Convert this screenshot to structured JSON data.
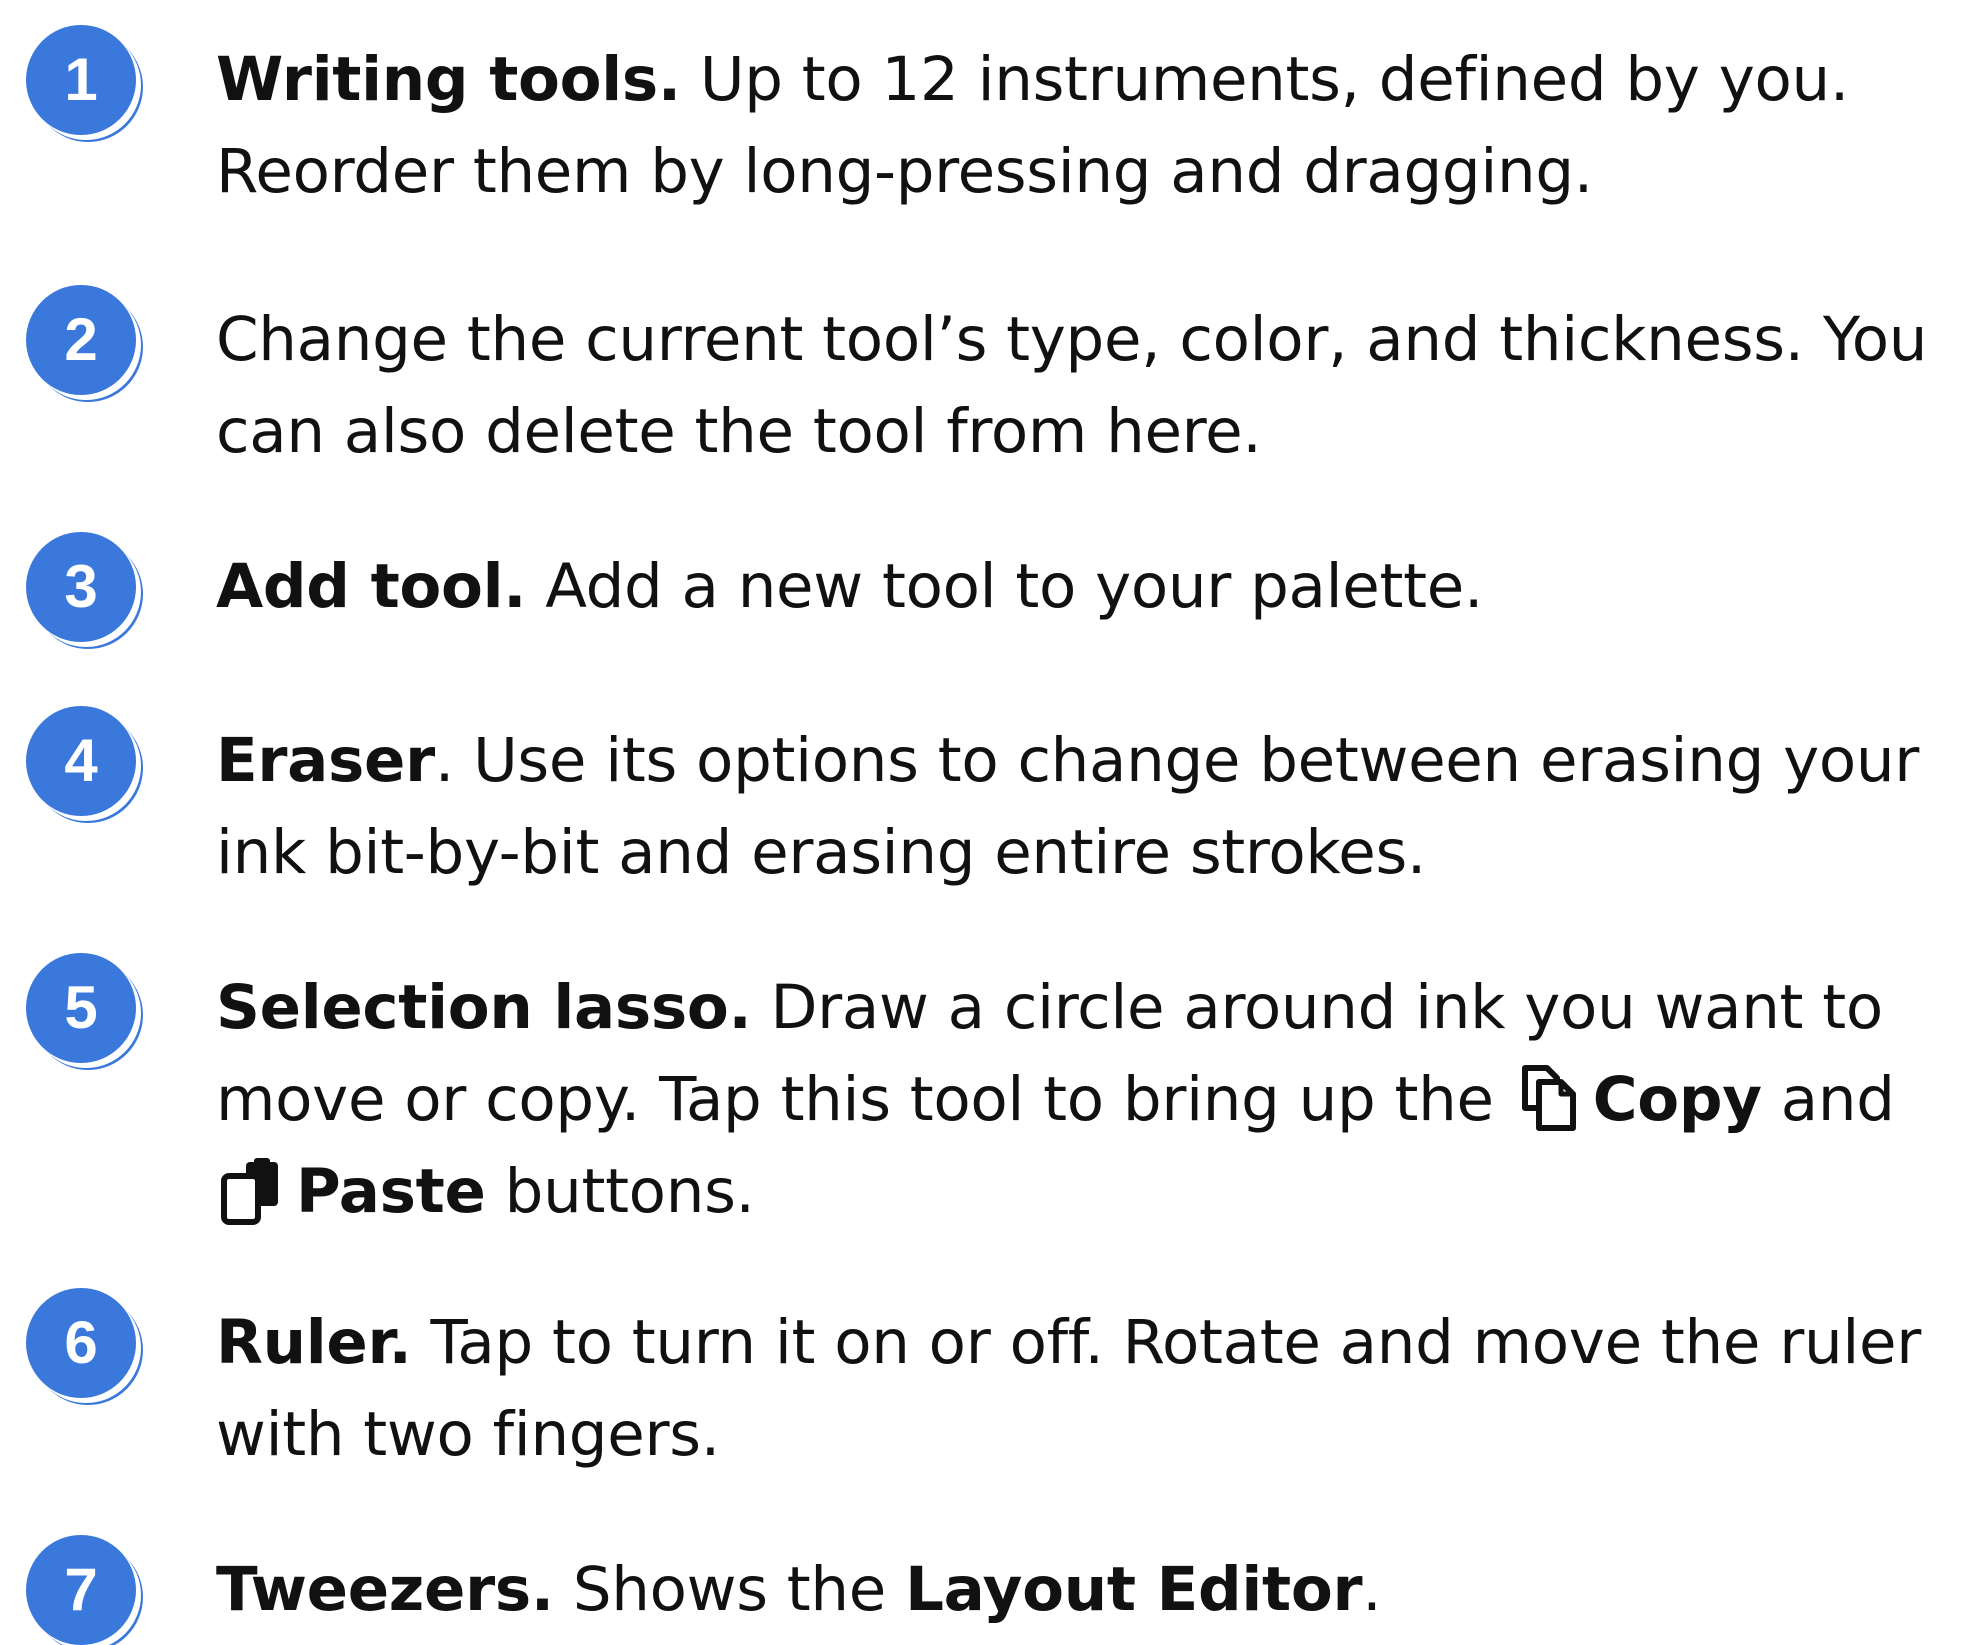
{
  "items": [
    {
      "number": "1",
      "title": "Writing tools.",
      "line1": " Up to 12 instruments, defined by you.",
      "line2": "Reorder them by long-pressing and dragging."
    },
    {
      "number": "2",
      "line1": "Change the current tool’s type, color, and thickness. You",
      "line2": "can also delete the tool from here."
    },
    {
      "number": "3",
      "title": "Add tool.",
      "line1": " Add a new tool to your palette."
    },
    {
      "number": "4",
      "title": "Eraser",
      "line1": ". Use its options to change between erasing your",
      "line2": "ink bit-by-bit and erasing entire strokes."
    },
    {
      "number": "5",
      "title": "Selection lasso.",
      "line1": " Draw a circle around ink you want to",
      "line2": "move or copy. Tap this tool to bring up the ",
      "copy_icon": "copy-icon",
      "copy_label": "Copy",
      "and_text": " and",
      "paste_icon": "paste-icon",
      "paste_label": "Paste",
      "line3": " buttons."
    },
    {
      "number": "6",
      "title": "Ruler.",
      "line1": " Tap to turn it on or off. Rotate and move the ruler",
      "line2": "with two fingers."
    },
    {
      "number": "7",
      "title": "Tweezers.",
      "line1": " Shows the ",
      "bold_label": "Layout Editor",
      "line1_end": "."
    }
  ],
  "colors": {
    "badge": "#3b78dc",
    "text": "#111111"
  }
}
